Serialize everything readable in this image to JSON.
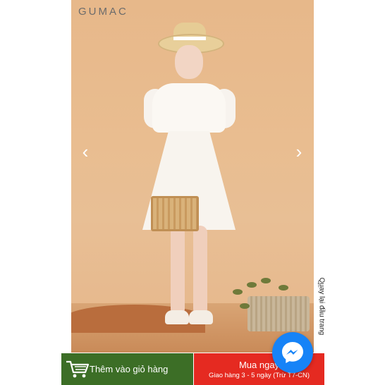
{
  "brand": {
    "logo_text": "GUMAC"
  },
  "gallery": {
    "prev_icon": "chevron-left-icon",
    "next_icon": "chevron-right-icon",
    "prev_glyph": "‹",
    "next_glyph": "›"
  },
  "back_to_top": {
    "label": "Quay lại đầu trang",
    "arrow": "↑"
  },
  "actions": {
    "add_to_cart": {
      "label": "Thêm vào giỏ hàng",
      "icon": "cart-icon"
    },
    "buy_now": {
      "label": "Mua ngay",
      "delivery_note": "Giao hàng 3 - 5 ngày (Trừ T7-CN)"
    }
  },
  "chat": {
    "icon": "messenger-icon"
  },
  "colors": {
    "cart_green": "#3c6e26",
    "buy_red": "#e52a21",
    "messenger_blue": "#1683f7",
    "background": "#e7b88a"
  }
}
